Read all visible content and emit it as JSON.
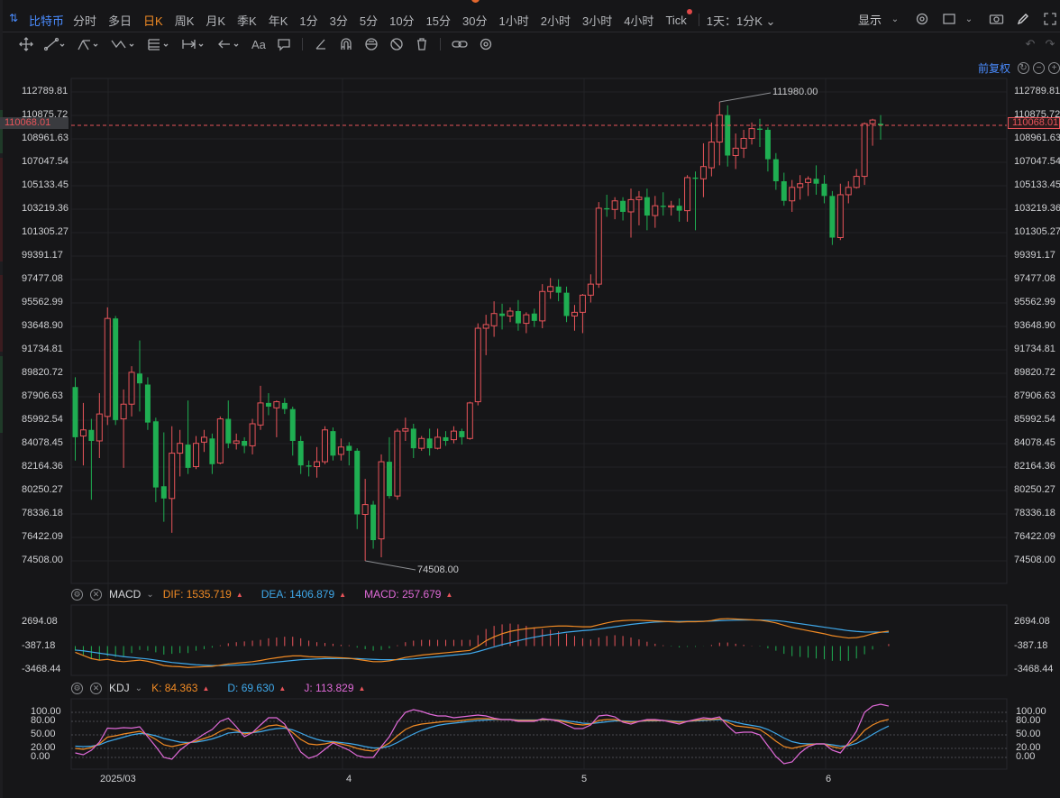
{
  "symbol": "比特币",
  "timeframes": [
    "分时",
    "多日",
    "日K",
    "周K",
    "月K",
    "季K",
    "年K",
    "1分",
    "3分",
    "5分",
    "10分",
    "15分",
    "30分",
    "1小时",
    "2小时",
    "3小时",
    "4小时",
    "Tick"
  ],
  "active_timeframe": "日K",
  "timeframe_mode": "1天：1分K",
  "display_label": "显示",
  "adjust_label": "前复权",
  "colors": {
    "up": "#e8545a",
    "down": "#1fae52",
    "dif": "#f08a24",
    "dea": "#3fa8ea",
    "macd": "#e06ad8",
    "k": "#f08a24",
    "d": "#3fa8ea",
    "j": "#e06ad8",
    "accent": "#4a8cff",
    "last_price": "#e8545a"
  },
  "icons": [
    "crosshair-icon",
    "trend-line-icon",
    "fork-icon",
    "wave-icon",
    "fib-icon",
    "range-icon",
    "arrow-icon",
    "text-icon",
    "note-icon",
    "ruler-icon",
    "magnet-icon",
    "lock-icon",
    "hide-icon",
    "trash-icon",
    "link-icon",
    "settings-icon",
    "camera-icon",
    "pen-icon",
    "layout-icon",
    "undo-icon",
    "redo-icon"
  ],
  "chart_data": {
    "type": "candlestick",
    "price_axis": {
      "labels": [
        "112789.81",
        "110875.72",
        "108961.63",
        "107047.54",
        "105133.45",
        "103219.36",
        "101305.27",
        "99391.17",
        "97477.08",
        "95562.99",
        "93648.90",
        "91734.81",
        "89820.72",
        "87906.63",
        "85992.54",
        "84078.45",
        "82164.36",
        "80250.27",
        "78336.18",
        "76422.09",
        "74508.00"
      ],
      "min": 74508.0,
      "max": 112789.81
    },
    "last_price": "110068.01",
    "high_marker": "111980.00",
    "low_marker": "74508.00",
    "x_labels": [
      "2025/03",
      "4",
      "5",
      "6"
    ],
    "candles": [
      {
        "o": 88700,
        "h": 89500,
        "l": 82700,
        "c": 84600
      },
      {
        "o": 84700,
        "h": 87400,
        "l": 82300,
        "c": 85200
      },
      {
        "o": 85200,
        "h": 86100,
        "l": 79500,
        "c": 84300
      },
      {
        "o": 84300,
        "h": 88200,
        "l": 82900,
        "c": 86500
      },
      {
        "o": 86300,
        "h": 95200,
        "l": 85600,
        "c": 94300
      },
      {
        "o": 94300,
        "h": 94500,
        "l": 85600,
        "c": 86000
      },
      {
        "o": 86100,
        "h": 88500,
        "l": 82100,
        "c": 87300
      },
      {
        "o": 87300,
        "h": 90400,
        "l": 86300,
        "c": 89900
      },
      {
        "o": 89800,
        "h": 92500,
        "l": 86700,
        "c": 89000
      },
      {
        "o": 88900,
        "h": 89500,
        "l": 85200,
        "c": 85800
      },
      {
        "o": 85900,
        "h": 86200,
        "l": 79300,
        "c": 80500
      },
      {
        "o": 80600,
        "h": 85000,
        "l": 77700,
        "c": 79600
      },
      {
        "o": 79600,
        "h": 85500,
        "l": 76800,
        "c": 83300
      },
      {
        "o": 83300,
        "h": 85200,
        "l": 81400,
        "c": 84100
      },
      {
        "o": 84000,
        "h": 87600,
        "l": 81600,
        "c": 82100
      },
      {
        "o": 82200,
        "h": 84700,
        "l": 82000,
        "c": 84100
      },
      {
        "o": 84200,
        "h": 85200,
        "l": 83400,
        "c": 84600
      },
      {
        "o": 84500,
        "h": 84900,
        "l": 81600,
        "c": 82400
      },
      {
        "o": 82500,
        "h": 86300,
        "l": 82400,
        "c": 86100
      },
      {
        "o": 86100,
        "h": 87600,
        "l": 83700,
        "c": 84100
      },
      {
        "o": 84100,
        "h": 84900,
        "l": 83600,
        "c": 84300
      },
      {
        "o": 84300,
        "h": 84600,
        "l": 83300,
        "c": 83900
      },
      {
        "o": 83900,
        "h": 86100,
        "l": 83200,
        "c": 85700
      },
      {
        "o": 85600,
        "h": 88800,
        "l": 85200,
        "c": 87400
      },
      {
        "o": 87400,
        "h": 88200,
        "l": 86400,
        "c": 87100
      },
      {
        "o": 87000,
        "h": 87600,
        "l": 84600,
        "c": 87500
      },
      {
        "o": 87400,
        "h": 87800,
        "l": 86500,
        "c": 86900
      },
      {
        "o": 86900,
        "h": 87100,
        "l": 83100,
        "c": 84300
      },
      {
        "o": 84300,
        "h": 84700,
        "l": 81600,
        "c": 82300
      },
      {
        "o": 82300,
        "h": 82700,
        "l": 81400,
        "c": 82200
      },
      {
        "o": 82200,
        "h": 83800,
        "l": 81300,
        "c": 82600
      },
      {
        "o": 82600,
        "h": 85500,
        "l": 82400,
        "c": 85200
      },
      {
        "o": 85100,
        "h": 85400,
        "l": 82700,
        "c": 83100
      },
      {
        "o": 83200,
        "h": 84500,
        "l": 82700,
        "c": 83800
      },
      {
        "o": 83900,
        "h": 84200,
        "l": 82300,
        "c": 83500
      },
      {
        "o": 83500,
        "h": 83700,
        "l": 77100,
        "c": 78300
      },
      {
        "o": 78300,
        "h": 81200,
        "l": 74508,
        "c": 79100
      },
      {
        "o": 79100,
        "h": 79400,
        "l": 75500,
        "c": 76200
      },
      {
        "o": 76300,
        "h": 83200,
        "l": 74800,
        "c": 82600
      },
      {
        "o": 82600,
        "h": 84600,
        "l": 79600,
        "c": 79800
      },
      {
        "o": 79800,
        "h": 85300,
        "l": 79500,
        "c": 85100
      },
      {
        "o": 85100,
        "h": 86200,
        "l": 84300,
        "c": 85300
      },
      {
        "o": 85300,
        "h": 85700,
        "l": 82900,
        "c": 83700
      },
      {
        "o": 83700,
        "h": 84700,
        "l": 83500,
        "c": 84500
      },
      {
        "o": 84500,
        "h": 85300,
        "l": 83100,
        "c": 83700
      },
      {
        "o": 83700,
        "h": 85300,
        "l": 83600,
        "c": 84600
      },
      {
        "o": 84600,
        "h": 85100,
        "l": 83900,
        "c": 84300
      },
      {
        "o": 84400,
        "h": 85500,
        "l": 84100,
        "c": 85100
      },
      {
        "o": 85100,
        "h": 85300,
        "l": 84000,
        "c": 84600
      },
      {
        "o": 84500,
        "h": 87500,
        "l": 84400,
        "c": 87400
      },
      {
        "o": 87500,
        "h": 93900,
        "l": 87200,
        "c": 93500
      },
      {
        "o": 93500,
        "h": 94600,
        "l": 91300,
        "c": 93800
      },
      {
        "o": 93700,
        "h": 95700,
        "l": 92800,
        "c": 94700
      },
      {
        "o": 94700,
        "h": 95500,
        "l": 93400,
        "c": 94500
      },
      {
        "o": 94500,
        "h": 95200,
        "l": 94000,
        "c": 94900
      },
      {
        "o": 94900,
        "h": 95800,
        "l": 93300,
        "c": 93900
      },
      {
        "o": 93900,
        "h": 94800,
        "l": 93100,
        "c": 94600
      },
      {
        "o": 94700,
        "h": 95100,
        "l": 93600,
        "c": 94100
      },
      {
        "o": 94100,
        "h": 97100,
        "l": 93500,
        "c": 96500
      },
      {
        "o": 96500,
        "h": 97600,
        "l": 95900,
        "c": 96900
      },
      {
        "o": 96900,
        "h": 97500,
        "l": 95700,
        "c": 96400
      },
      {
        "o": 96400,
        "h": 96900,
        "l": 94000,
        "c": 94500
      },
      {
        "o": 94500,
        "h": 95400,
        "l": 93300,
        "c": 94800
      },
      {
        "o": 94800,
        "h": 96300,
        "l": 93100,
        "c": 96200
      },
      {
        "o": 96200,
        "h": 97900,
        "l": 95600,
        "c": 97100
      },
      {
        "o": 97100,
        "h": 103800,
        "l": 96800,
        "c": 103300
      },
      {
        "o": 103300,
        "h": 104400,
        "l": 102600,
        "c": 103200
      },
      {
        "o": 103200,
        "h": 104200,
        "l": 102400,
        "c": 103900
      },
      {
        "o": 103900,
        "h": 104200,
        "l": 102300,
        "c": 103000
      },
      {
        "o": 103000,
        "h": 104900,
        "l": 100900,
        "c": 104000
      },
      {
        "o": 104000,
        "h": 104700,
        "l": 101900,
        "c": 104200
      },
      {
        "o": 104200,
        "h": 104900,
        "l": 101500,
        "c": 102700
      },
      {
        "o": 102700,
        "h": 104300,
        "l": 101700,
        "c": 103500
      },
      {
        "o": 103500,
        "h": 104600,
        "l": 102700,
        "c": 103400
      },
      {
        "o": 103400,
        "h": 103900,
        "l": 102700,
        "c": 103500
      },
      {
        "o": 103500,
        "h": 104100,
        "l": 102200,
        "c": 103100
      },
      {
        "o": 103100,
        "h": 106000,
        "l": 102200,
        "c": 105800
      },
      {
        "o": 105800,
        "h": 106300,
        "l": 101500,
        "c": 105700
      },
      {
        "o": 105700,
        "h": 108600,
        "l": 104200,
        "c": 106700
      },
      {
        "o": 106600,
        "h": 110300,
        "l": 105900,
        "c": 108700
      },
      {
        "o": 108700,
        "h": 111980,
        "l": 106800,
        "c": 110900
      },
      {
        "o": 110900,
        "h": 111700,
        "l": 106700,
        "c": 107600
      },
      {
        "o": 107600,
        "h": 109400,
        "l": 106500,
        "c": 108200
      },
      {
        "o": 108200,
        "h": 109700,
        "l": 107400,
        "c": 109000
      },
      {
        "o": 109000,
        "h": 110300,
        "l": 108500,
        "c": 109800
      },
      {
        "o": 109800,
        "h": 110600,
        "l": 108300,
        "c": 109700
      },
      {
        "o": 109700,
        "h": 109900,
        "l": 106300,
        "c": 107300
      },
      {
        "o": 107300,
        "h": 107800,
        "l": 104800,
        "c": 105500
      },
      {
        "o": 105500,
        "h": 106200,
        "l": 103500,
        "c": 103900
      },
      {
        "o": 103900,
        "h": 105600,
        "l": 103000,
        "c": 105000
      },
      {
        "o": 105000,
        "h": 106000,
        "l": 104000,
        "c": 105300
      },
      {
        "o": 105400,
        "h": 105900,
        "l": 104300,
        "c": 105700
      },
      {
        "o": 105700,
        "h": 106800,
        "l": 104400,
        "c": 105300
      },
      {
        "o": 105300,
        "h": 106000,
        "l": 103700,
        "c": 104300
      },
      {
        "o": 104300,
        "h": 104700,
        "l": 100300,
        "c": 100900
      },
      {
        "o": 100900,
        "h": 105300,
        "l": 100700,
        "c": 104400
      },
      {
        "o": 104400,
        "h": 105500,
        "l": 103700,
        "c": 105000
      },
      {
        "o": 105000,
        "h": 106500,
        "l": 104900,
        "c": 105900
      },
      {
        "o": 105900,
        "h": 110300,
        "l": 105200,
        "c": 110200
      },
      {
        "o": 110200,
        "h": 110600,
        "l": 108400,
        "c": 110500
      },
      {
        "o": 110200,
        "h": 110900,
        "l": 108900,
        "c": 110068
      }
    ],
    "macd": {
      "name": "MACD",
      "params": [
        {
          "label": "DIF:",
          "value": "1535.719"
        },
        {
          "label": "DEA:",
          "value": "1406.879"
        },
        {
          "label": "MACD:",
          "value": "257.679"
        }
      ],
      "axis_labels": [
        "2694.08",
        "-387.18",
        "-3468.44"
      ],
      "range": [
        -3468.44,
        2694.08
      ],
      "dif": [
        -1200,
        -1600,
        -2000,
        -2200,
        -2100,
        -2300,
        -2400,
        -2300,
        -2200,
        -2350,
        -2600,
        -2900,
        -3000,
        -3050,
        -3150,
        -3100,
        -3050,
        -3000,
        -2850,
        -2700,
        -2600,
        -2500,
        -2400,
        -2250,
        -2050,
        -1900,
        -1750,
        -1650,
        -1650,
        -1750,
        -1800,
        -1800,
        -1850,
        -1900,
        -1950,
        -2100,
        -2250,
        -2400,
        -2400,
        -2300,
        -2100,
        -1850,
        -1700,
        -1550,
        -1450,
        -1350,
        -1250,
        -1150,
        -1050,
        -950,
        -400,
        300,
        800,
        1200,
        1500,
        1700,
        1850,
        1950,
        2050,
        2150,
        2200,
        2200,
        2150,
        2100,
        2100,
        2350,
        2600,
        2800,
        2900,
        2950,
        2950,
        2900,
        2850,
        2800,
        2750,
        2700,
        2750,
        2750,
        2800,
        2900,
        3100,
        3150,
        3100,
        3050,
        3000,
        2950,
        2800,
        2600,
        2300,
        2000,
        1800,
        1600,
        1400,
        1200,
        950,
        800,
        650,
        700,
        900,
        1200,
        1400,
        1535.719
      ],
      "dea": [
        -900,
        -1000,
        -1150,
        -1300,
        -1450,
        -1600,
        -1750,
        -1850,
        -1950,
        -2050,
        -2200,
        -2350,
        -2500,
        -2600,
        -2700,
        -2800,
        -2850,
        -2900,
        -2900,
        -2880,
        -2850,
        -2800,
        -2750,
        -2650,
        -2550,
        -2450,
        -2350,
        -2250,
        -2150,
        -2100,
        -2050,
        -2000,
        -2000,
        -1980,
        -2000,
        -2000,
        -2050,
        -2100,
        -2150,
        -2150,
        -2150,
        -2100,
        -2050,
        -1950,
        -1850,
        -1750,
        -1650,
        -1550,
        -1450,
        -1350,
        -1100,
        -800,
        -500,
        -200,
        50,
        300,
        550,
        750,
        950,
        1100,
        1250,
        1400,
        1500,
        1600,
        1680,
        1800,
        1950,
        2100,
        2250,
        2400,
        2520,
        2620,
        2700,
        2750,
        2780,
        2790,
        2800,
        2800,
        2810,
        2830,
        2880,
        2920,
        2950,
        2970,
        2980,
        2980,
        2950,
        2900,
        2800,
        2650,
        2500,
        2350,
        2200,
        2050,
        1900,
        1750,
        1600,
        1500,
        1430,
        1420,
        1410,
        1406.879
      ]
    },
    "kdj": {
      "name": "KDJ",
      "params": [
        {
          "label": "K:",
          "value": "84.363"
        },
        {
          "label": "D:",
          "value": "69.630"
        },
        {
          "label": "J:",
          "value": "113.829"
        }
      ],
      "axis_labels": [
        "100.00",
        "80.00",
        "50.00",
        "20.00",
        "0.00"
      ],
      "range": [
        0,
        100
      ],
      "k": [
        20,
        18,
        22,
        30,
        45,
        48,
        52,
        55,
        58,
        50,
        40,
        28,
        24,
        28,
        32,
        36,
        42,
        48,
        58,
        65,
        60,
        52,
        55,
        62,
        70,
        72,
        68,
        55,
        40,
        30,
        28,
        30,
        34,
        30,
        26,
        20,
        16,
        14,
        22,
        32,
        48,
        62,
        70,
        74,
        76,
        78,
        80,
        80,
        82,
        84,
        86,
        86,
        85,
        84,
        84,
        82,
        82,
        82,
        84,
        84,
        82,
        78,
        74,
        72,
        74,
        82,
        84,
        84,
        80,
        78,
        80,
        82,
        82,
        82,
        80,
        78,
        80,
        82,
        84,
        84,
        86,
        78,
        70,
        68,
        66,
        62,
        50,
        36,
        24,
        20,
        24,
        28,
        30,
        30,
        24,
        20,
        28,
        40,
        60,
        72,
        80,
        84.363
      ],
      "d": [
        25,
        24,
        25,
        28,
        35,
        40,
        45,
        50,
        53,
        52,
        48,
        42,
        38,
        34,
        33,
        34,
        37,
        41,
        47,
        54,
        56,
        55,
        55,
        57,
        61,
        64,
        65,
        61,
        54,
        46,
        40,
        36,
        35,
        33,
        31,
        28,
        24,
        21,
        21,
        25,
        33,
        43,
        52,
        60,
        66,
        71,
        74,
        76,
        78,
        80,
        82,
        83,
        84,
        84,
        84,
        83,
        83,
        83,
        83,
        84,
        83,
        81,
        79,
        76,
        75,
        77,
        79,
        81,
        81,
        80,
        80,
        81,
        81,
        82,
        81,
        80,
        80,
        81,
        82,
        83,
        84,
        82,
        78,
        74,
        71,
        68,
        62,
        53,
        43,
        35,
        31,
        30,
        30,
        30,
        28,
        25,
        26,
        31,
        40,
        51,
        61,
        69.63
      ],
      "j": [
        10,
        6,
        16,
        34,
        65,
        64,
        66,
        65,
        68,
        46,
        24,
        0,
        -4,
        16,
        30,
        40,
        52,
        62,
        80,
        87,
        68,
        46,
        55,
        72,
        88,
        88,
        74,
        43,
        12,
        -2,
        4,
        18,
        32,
        24,
        16,
        4,
        0,
        0,
        24,
        46,
        78,
        100,
        106,
        102,
        96,
        92,
        92,
        88,
        90,
        92,
        94,
        92,
        87,
        84,
        84,
        80,
        80,
        80,
        86,
        84,
        80,
        72,
        64,
        64,
        72,
        92,
        94,
        90,
        78,
        74,
        80,
        84,
        84,
        82,
        78,
        74,
        80,
        84,
        88,
        86,
        90,
        70,
        54,
        56,
        56,
        50,
        26,
        2,
        -14,
        -10,
        10,
        24,
        30,
        30,
        16,
        10,
        32,
        58,
        100,
        114,
        118,
        113.829
      ]
    }
  }
}
